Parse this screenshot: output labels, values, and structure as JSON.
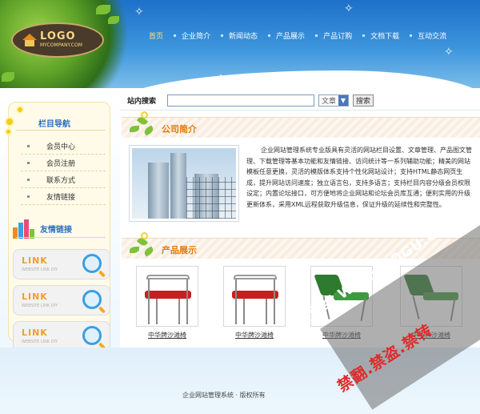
{
  "colors": {
    "header_blue": "#2a7fd2",
    "nav_active": "#ffe27a",
    "sidebar_title": "#2a6fbf",
    "section_title": "#e07a10",
    "link_orange": "#f0a025",
    "watermark_red": "#e02a2a"
  },
  "header": {
    "logo": {
      "main": "LOGO",
      "sub": "MYCOMPANY.COM"
    },
    "nav": [
      {
        "label": "首页",
        "active": true
      },
      {
        "label": "企业简介"
      },
      {
        "label": "新闻动态"
      },
      {
        "label": "产品展示"
      },
      {
        "label": "产品订购"
      },
      {
        "label": "文档下载"
      },
      {
        "label": "互动交流"
      }
    ]
  },
  "sidebar": {
    "title": "栏目导航",
    "items": [
      {
        "label": "会员中心"
      },
      {
        "label": "会员注册"
      },
      {
        "label": "联系方式"
      },
      {
        "label": "友情链接"
      }
    ],
    "friends_title": "友情链接",
    "links": [
      {
        "label": "LINK",
        "sub": "WEBSITE LINK DIY",
        "icon": "magnifier-icon"
      },
      {
        "label": "LINK",
        "sub": "WEBSITE LINK DIY",
        "icon": "magnifier-icon"
      },
      {
        "label": "LINK",
        "sub": "WEBSITE LINK DIY",
        "icon": "magnifier-icon"
      }
    ]
  },
  "search": {
    "label": "站内搜索",
    "value": "",
    "select_value": "文章",
    "button": "搜索"
  },
  "about": {
    "title": "公司简介",
    "text": "企业网站管理系统专业版具有灵活的网站栏目设置、文章管理、产品图文管理、下载管理等基本功能和友情链接、访问统计等一系列辅助功能；精美的网站模板任意更换，灵活的模版体系支持个性化网站设计；支持HTML静态网页生成，提升网站访问速度；独立语言包，支持多语言；支持栏目内容分级会员权限设定；内置论坛接口，可方便地将企业网站和论坛会员库互通；便利实用的升级更新体系，采用XML远程获取升级信息，保证升级的延续性和完整性。"
  },
  "products": {
    "title": "产品展示",
    "items": [
      {
        "name": "中华牌沙滩椅",
        "seat_color": "#c81e1e"
      },
      {
        "name": "中华牌沙滩椅",
        "seat_color": "#c81e1e"
      },
      {
        "name": "中华牌沙滩椅",
        "seat_color": "#2e7a2e"
      },
      {
        "name": "中华牌沙滩椅",
        "seat_color": "#2e7a2e"
      }
    ]
  },
  "footer": {
    "text": "企业网站管理系统 · 版权所有"
  },
  "watermark": {
    "line1": "优古网络 WWW.EOGU.COM",
    "line2": "禁翻.禁盗.禁转"
  }
}
